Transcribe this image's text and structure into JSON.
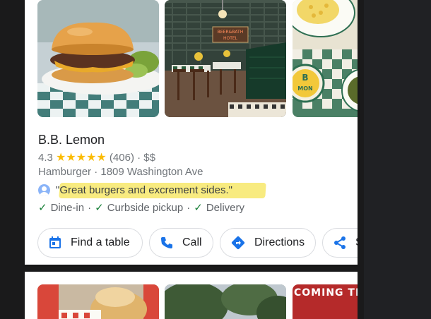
{
  "place": {
    "name": "B.B. Lemon",
    "rating": "4.3",
    "stars_glyph": "★★★★★",
    "review_count": "(406)",
    "price": "$$",
    "rating_sep": "·",
    "category": "Hamburger",
    "address": "1809 Washington Ave",
    "address_sep": "·"
  },
  "review": {
    "text": "\"Great burgers and excrement sides.\""
  },
  "services": [
    {
      "label": "Dine-in",
      "sep": "·"
    },
    {
      "label": "Curbside pickup",
      "sep": "·"
    },
    {
      "label": "Delivery",
      "sep": ""
    }
  ],
  "actions": {
    "find_table": "Find a table",
    "call": "Call",
    "directions": "Directions",
    "share": "S"
  },
  "photos": {
    "sign_text": "BEER & BATH HOTEL",
    "lemon_badge": "B LMON",
    "next_card_sign": "COMING THE"
  },
  "colors": {
    "star": "#fbbc04",
    "check": "#188038",
    "action_blue": "#1a73e8",
    "highlight": "#f7e86a"
  }
}
